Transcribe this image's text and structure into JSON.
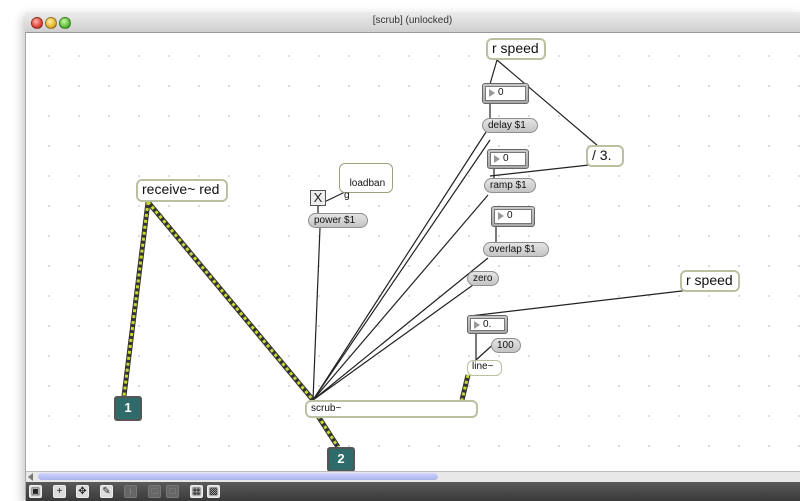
{
  "window": {
    "title": "[scrub] (unlocked)"
  },
  "objects": {
    "r_speed_top": "r speed",
    "r_speed_right": "r speed",
    "receive_red": "receive~ red",
    "loadbang": "loadban\ng",
    "div3": "/ 3.",
    "scrub": "scrub~",
    "line": "line~",
    "zero": "zero"
  },
  "messages": {
    "delay": "delay $1",
    "ramp": "ramp $1",
    "overlap": "overlap $1",
    "power": "power $1",
    "hundred": "100"
  },
  "numbers": {
    "n1": "0",
    "n2": "0",
    "n3": "0",
    "n4": "0."
  },
  "toggle": {
    "symbol": "X"
  },
  "outlets": {
    "out1": "1",
    "out2": "2"
  },
  "colors": {
    "signal_patchcord": "#c8d832",
    "object_border": "#b9c1a0",
    "outlet_fill": "#2f6b6b"
  },
  "toolbar": {
    "icons": [
      "lock-icon",
      "new-object-icon",
      "pan-icon",
      "inspector-icon",
      "info-icon",
      "disabled-icon-1",
      "disabled-icon-2",
      "grid-icon",
      "snap-icon"
    ]
  }
}
